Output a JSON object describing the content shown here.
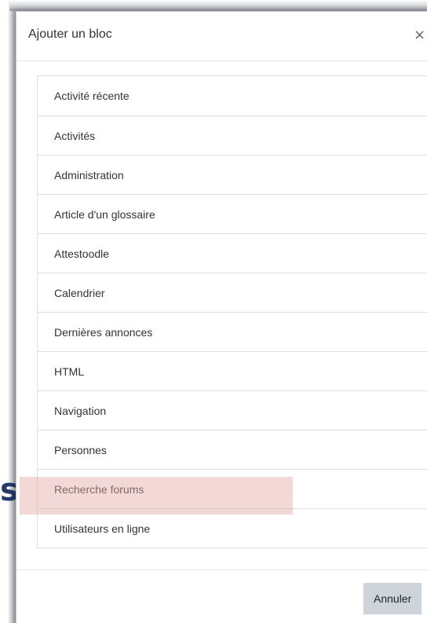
{
  "modal": {
    "title": "Ajouter un bloc",
    "close_symbol": "×",
    "cancel_label": "Annuler"
  },
  "background": {
    "partial_letter": "s"
  },
  "blocks": [
    {
      "label": "Activité récente"
    },
    {
      "label": "Activités"
    },
    {
      "label": "Administration"
    },
    {
      "label": "Article d'un glossaire"
    },
    {
      "label": "Attestoodle"
    },
    {
      "label": "Calendrier"
    },
    {
      "label": "Dernières annonces"
    },
    {
      "label": "HTML"
    },
    {
      "label": "Navigation"
    },
    {
      "label": "Personnes"
    },
    {
      "label": "Recherche forums",
      "highlighted": true
    },
    {
      "label": "Utilisateurs en ligne"
    }
  ],
  "colors": {
    "highlight": "#e2aaa8",
    "cancel_button_bg": "#ced4da",
    "text": "#333333"
  }
}
